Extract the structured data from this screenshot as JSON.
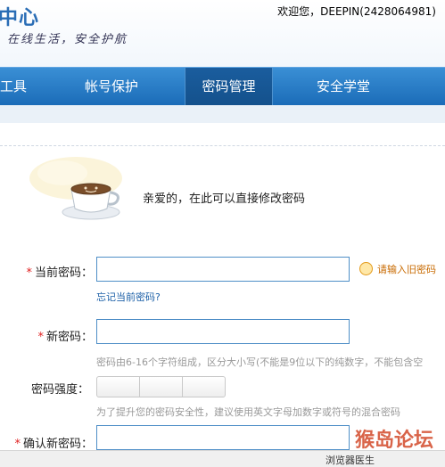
{
  "header": {
    "logo_title": "中心",
    "slogan": "在线生活，安全护航",
    "welcome": "欢迎您，DEEPIN(2428064981)"
  },
  "nav": {
    "items": [
      {
        "label": "工具",
        "active": false
      },
      {
        "label": "帐号保护",
        "active": false
      },
      {
        "label": "密码管理",
        "active": true
      },
      {
        "label": "安全学堂",
        "active": false
      }
    ]
  },
  "intro": {
    "text": "亲爱的，在此可以直接修改密码"
  },
  "form": {
    "current_password": {
      "label": "当前密码：",
      "value": "",
      "warning": "请输入旧密码",
      "forgot_link": "忘记当前密码?"
    },
    "new_password": {
      "label": "新密码：",
      "value": "",
      "hint": "密码由6-16个字符组成，区分大小写(不能是9位以下的纯数字，不能包含空"
    },
    "strength": {
      "label": "密码强度：",
      "hint": "为了提升您的密码安全性，建议使用英文字母加数字或符号的混合密码"
    },
    "confirm_password": {
      "label": "确认新密码：",
      "value": ""
    },
    "required_mark": "*"
  },
  "statusbar": {
    "text": "浏览器医生"
  },
  "watermark": {
    "text": "猴岛论坛"
  },
  "colors": {
    "nav_bg": "#1b6cb8",
    "input_border": "#4f8fc7",
    "required": "#e02020",
    "link": "#1b5fa7",
    "warning": "#c86a00"
  }
}
